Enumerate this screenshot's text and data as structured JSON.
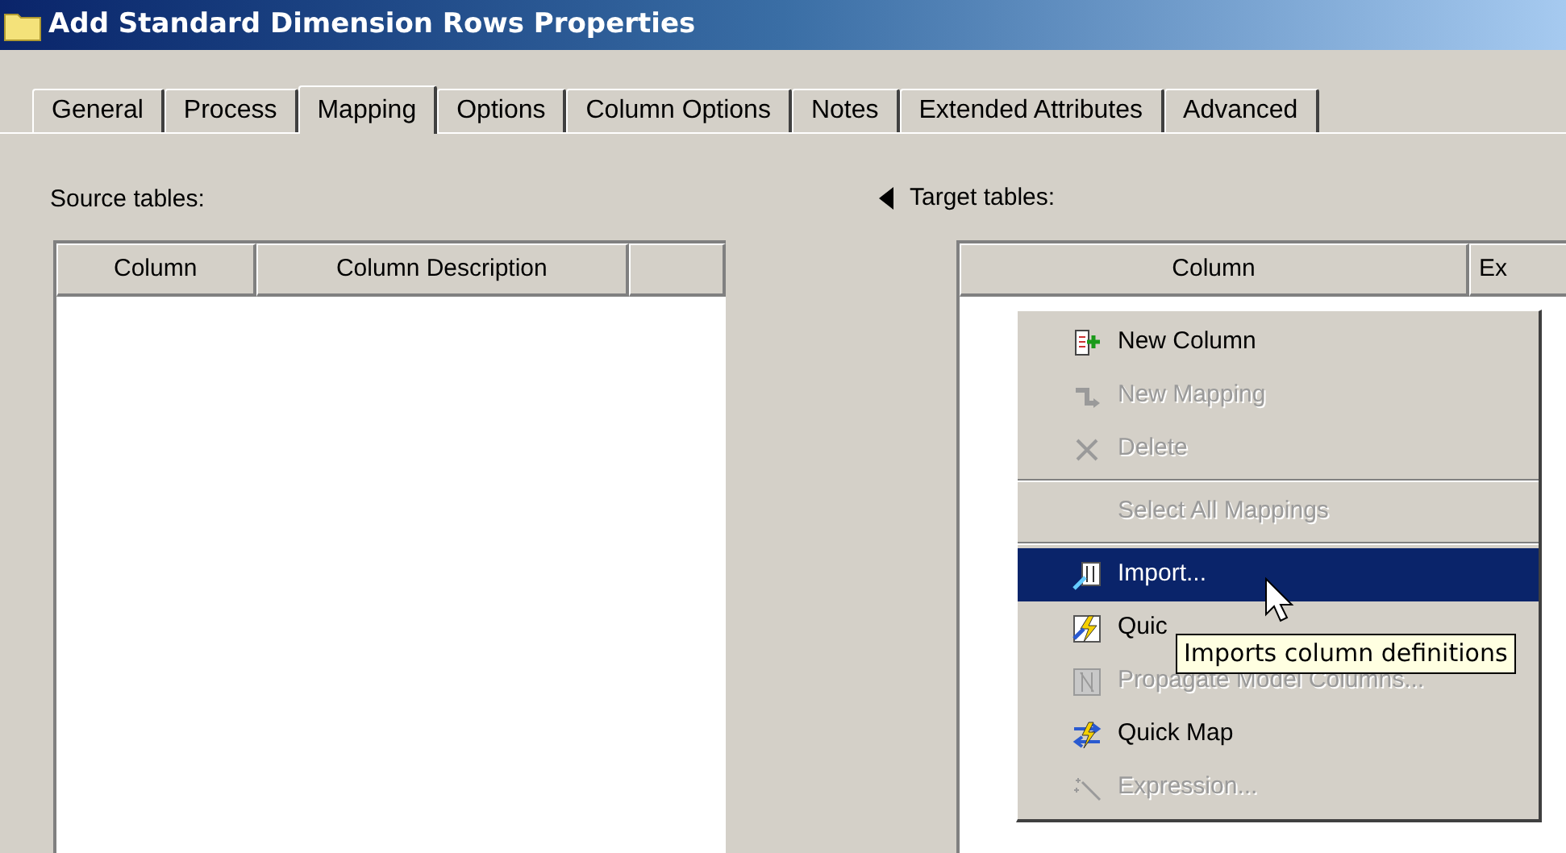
{
  "window": {
    "title": "Add Standard Dimension Rows Properties"
  },
  "tabs": [
    {
      "label": "General",
      "selected": false
    },
    {
      "label": "Process",
      "selected": false
    },
    {
      "label": "Mapping",
      "selected": true
    },
    {
      "label": "Options",
      "selected": false
    },
    {
      "label": "Column Options",
      "selected": false
    },
    {
      "label": "Notes",
      "selected": false
    },
    {
      "label": "Extended Attributes",
      "selected": false
    },
    {
      "label": "Advanced",
      "selected": false
    }
  ],
  "source": {
    "label": "Source tables:",
    "columns": [
      "Column",
      "Column Description",
      ""
    ]
  },
  "target": {
    "label": "Target tables:",
    "columns": [
      "Column",
      "Ex"
    ]
  },
  "context_menu": {
    "items": [
      {
        "kind": "item",
        "label": "New Column",
        "disabled": false,
        "selected": false
      },
      {
        "kind": "item",
        "label": "New Mapping",
        "disabled": true,
        "selected": false
      },
      {
        "kind": "item",
        "label": "Delete",
        "disabled": true,
        "selected": false
      },
      {
        "kind": "separator"
      },
      {
        "kind": "item",
        "label": "Select All Mappings",
        "disabled": true,
        "selected": false
      },
      {
        "kind": "separator"
      },
      {
        "kind": "item",
        "label": "Import...",
        "disabled": false,
        "selected": true
      },
      {
        "kind": "item",
        "label": "Quic",
        "disabled": false,
        "selected": false
      },
      {
        "kind": "item",
        "label": "Propagate Model Columns...",
        "disabled": true,
        "selected": false
      },
      {
        "kind": "item",
        "label": "Quick Map",
        "disabled": false,
        "selected": false
      },
      {
        "kind": "item",
        "label": "Expression...",
        "disabled": true,
        "selected": false
      }
    ]
  },
  "tooltip": {
    "text": "Imports column definitions"
  }
}
